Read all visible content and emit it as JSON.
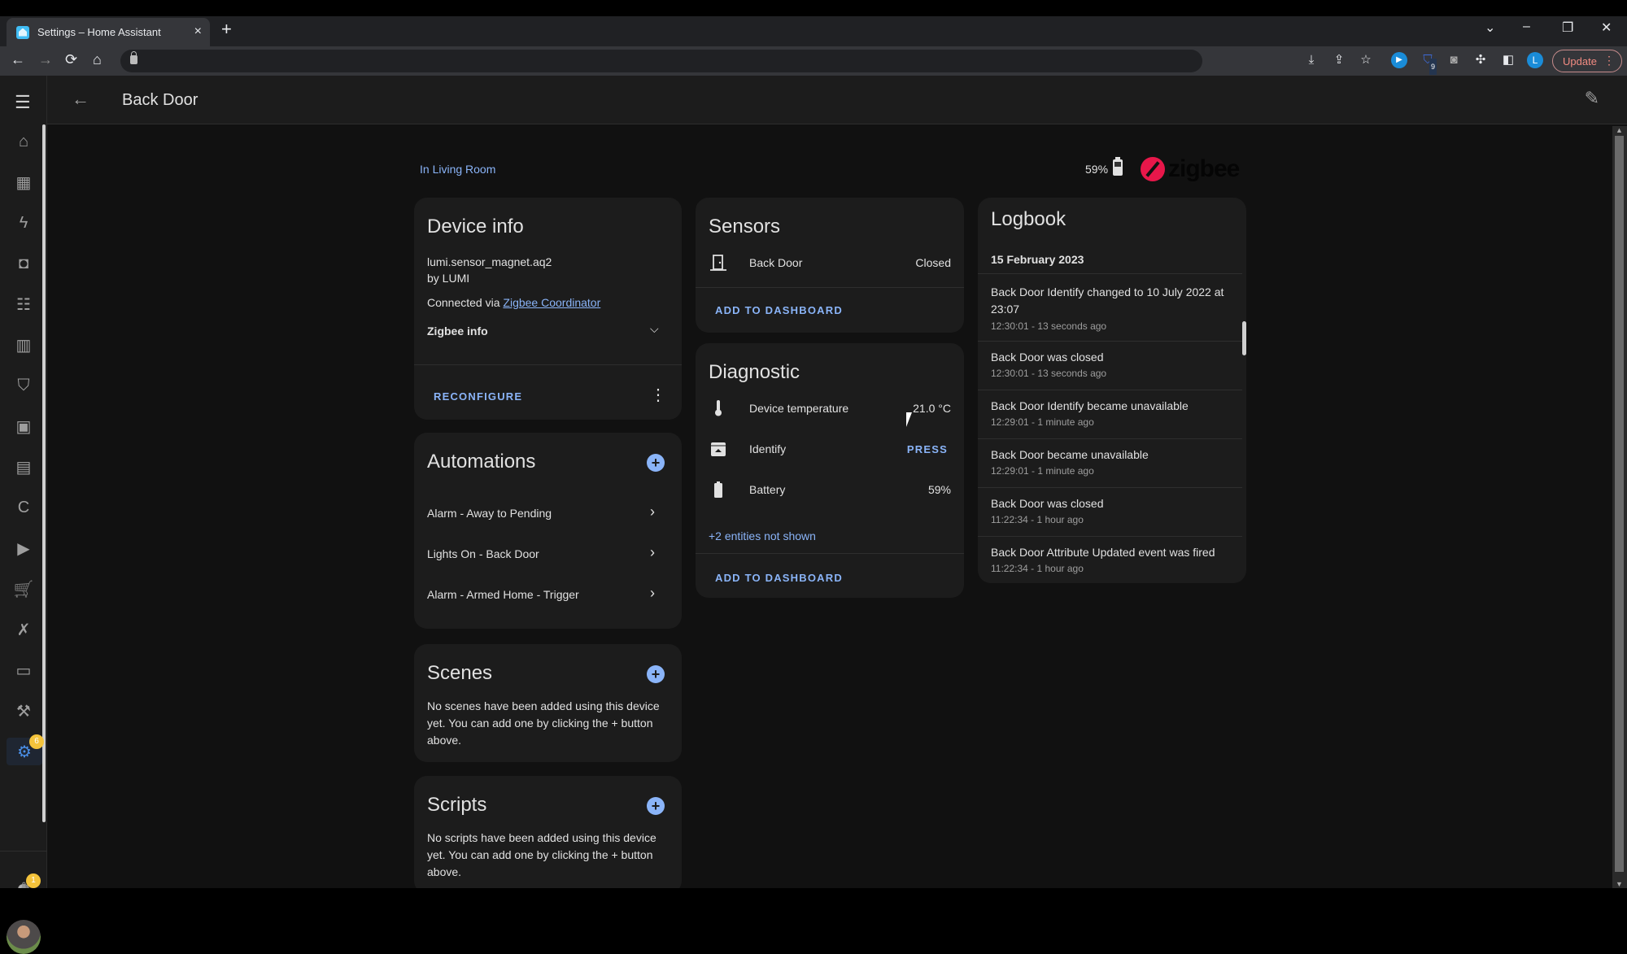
{
  "browser": {
    "tab_title": "Settings – Home Assistant",
    "tab_close": "×",
    "new_tab": "+",
    "window_controls": {
      "dropdown": "⌄",
      "minimize": "–",
      "restore": "❐",
      "close": "✕"
    },
    "nav": {
      "back": "←",
      "forward": "→",
      "reload": "⟳",
      "home": "⌂"
    },
    "extensions": [
      "download-icon",
      "share-icon",
      "star-icon",
      "ext-blue-icon",
      "ext-shield-icon",
      "camera-icon",
      "puzzle-icon",
      "sidepanel-icon"
    ],
    "extension_badge": "9",
    "profile_initial": "L",
    "update_label": "Update",
    "update_menu": "⋮"
  },
  "header": {
    "title": "Back Door",
    "back_icon": "←",
    "edit_icon": "✎"
  },
  "sidebar": {
    "menu_icon": "☰",
    "items": [
      {
        "name": "overview",
        "icon": "⌂"
      },
      {
        "name": "dashboards",
        "icon": "▦"
      },
      {
        "name": "energy",
        "icon": "ϟ"
      },
      {
        "name": "map",
        "icon": "◘"
      },
      {
        "name": "logbook",
        "icon": "☷"
      },
      {
        "name": "history",
        "icon": "▥"
      },
      {
        "name": "alarm",
        "icon": "⛉"
      },
      {
        "name": "calendar",
        "icon": "▣"
      },
      {
        "name": "esphome",
        "icon": "▤"
      },
      {
        "name": "c-addon",
        "icon": "C"
      },
      {
        "name": "media",
        "icon": "▶"
      },
      {
        "name": "shopping-list",
        "icon": "🛒"
      },
      {
        "name": "vscode",
        "icon": "✗"
      },
      {
        "name": "terminal",
        "icon": "▭"
      },
      {
        "name": "developer-tools",
        "icon": "⚒"
      },
      {
        "name": "settings",
        "icon": "⚙",
        "badge": "6",
        "active": true
      }
    ],
    "notifications": {
      "icon": "🔔",
      "badge": "1"
    }
  },
  "device": {
    "area_link": "In Living Room",
    "battery_level": "59%",
    "integration_logo": "zigbee"
  },
  "device_info": {
    "title": "Device info",
    "model": "lumi.sensor_magnet.aq2",
    "manufacturer": "by LUMI",
    "connected_via_prefix": "Connected via ",
    "connected_via_link": "Zigbee Coordinator",
    "zigbee_info_label": "Zigbee info",
    "reconfigure_label": "RECONFIGURE",
    "more_icon": "⋮"
  },
  "automations": {
    "title": "Automations",
    "items": [
      {
        "label": "Alarm - Away to Pending"
      },
      {
        "label": "Lights On - Back Door"
      },
      {
        "label": "Alarm - Armed Home - Trigger"
      }
    ]
  },
  "scenes": {
    "title": "Scenes",
    "empty_text": "No scenes have been added using this device yet. You can add one by clicking the + button above."
  },
  "scripts": {
    "title": "Scripts",
    "empty_text": "No scripts have been added using this device yet. You can add one by clicking the + button above."
  },
  "sensors": {
    "title": "Sensors",
    "rows": [
      {
        "name": "Back Door",
        "state": "Closed",
        "icon": "door-closed-icon"
      }
    ],
    "add_to_dashboard": "ADD TO DASHBOARD"
  },
  "diagnostic": {
    "title": "Diagnostic",
    "rows": [
      {
        "name": "Device temperature",
        "state": "21.0 °C",
        "icon": "thermometer-icon"
      },
      {
        "name": "Identify",
        "state": "PRESS",
        "icon": "identify-button-icon"
      },
      {
        "name": "Battery",
        "state": "59%",
        "icon": "battery-icon"
      }
    ],
    "hidden_entities": "+2 entities not shown",
    "add_to_dashboard": "ADD TO DASHBOARD"
  },
  "logbook": {
    "title": "Logbook",
    "date": "15 February 2023",
    "entries": [
      {
        "message": "Back Door Identify changed to 10 July 2022 at 23:07",
        "time": "12:30:01 - 13 seconds ago"
      },
      {
        "message": "Back Door was closed",
        "time": "12:30:01 - 13 seconds ago"
      },
      {
        "message": "Back Door Identify became unavailable",
        "time": "12:29:01 - 1 minute ago"
      },
      {
        "message": "Back Door became unavailable",
        "time": "12:29:01 - 1 minute ago"
      },
      {
        "message": "Back Door was closed",
        "time": "11:22:34 - 1 hour ago"
      },
      {
        "message": "Back Door Attribute Updated event was fired",
        "time": "11:22:34 - 1 hour ago"
      }
    ]
  },
  "colors": {
    "accent": "#8ab4f8",
    "active_sidebar": "#4a8fe7",
    "badge": "#f4c33b",
    "zigbee_red": "#e8174a",
    "card_bg": "#1c1c1c",
    "page_bg": "#111111"
  }
}
